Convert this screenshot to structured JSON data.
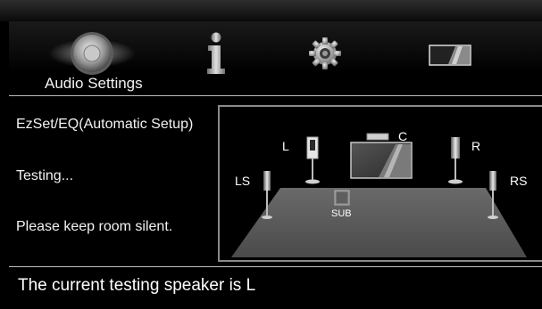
{
  "menu": {
    "items": [
      {
        "label": "Audio Settings",
        "icon": "speaker-icon"
      },
      {
        "label": "",
        "icon": "info-icon"
      },
      {
        "label": "",
        "icon": "gear-icon"
      },
      {
        "label": "",
        "icon": "tv-screen-icon"
      }
    ]
  },
  "setup": {
    "title": "EzSet/EQ(Automatic Setup)",
    "progress": "Testing...",
    "instruction": "Please keep room silent."
  },
  "speakers": {
    "left": "L",
    "center": "C",
    "right": "R",
    "left_surround": "LS",
    "right_surround": "RS",
    "subwoofer": "SUB"
  },
  "status": {
    "message": "The current testing speaker is L"
  },
  "colors": {
    "background": "#000000",
    "divider": "#bdbdbd",
    "floor": "#5a5a5a"
  }
}
